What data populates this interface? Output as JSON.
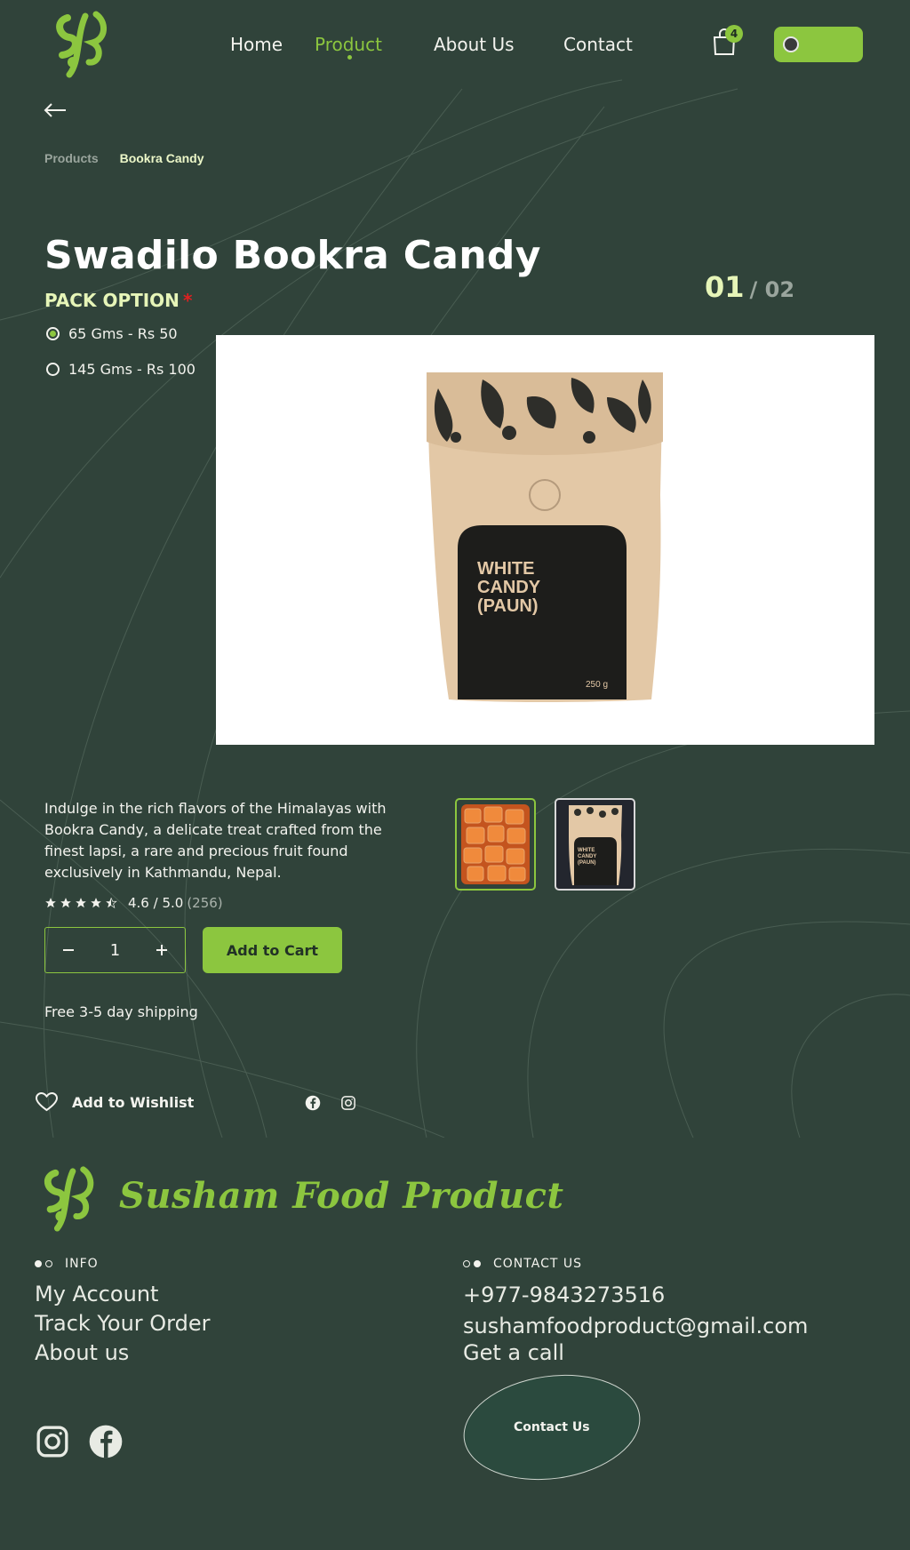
{
  "nav": {
    "links": [
      "Home",
      "Product",
      "About Us",
      "Contact"
    ],
    "active": "Product",
    "cart_count": "4"
  },
  "breadcrumb": [
    "Products",
    "Bookra Candy"
  ],
  "product": {
    "title": "Swadilo Bookra Candy",
    "pack_label": "PACK OPTION",
    "required_mark": "*",
    "options": [
      "65 Gms - Rs 50",
      "145 Gms - Rs 100"
    ],
    "selected_option": "65 Gms - Rs 50",
    "image_index": "01",
    "image_total": "/ 02",
    "package_text": [
      "WHITE",
      "CANDY",
      "(PAUN)"
    ],
    "package_weight": "250 g",
    "thumb_package_text": [
      "WHITE",
      "CANDY",
      "(PAUN)"
    ],
    "description": "Indulge in the rich flavors of the Himalayas with Bookra Candy, a delicate treat crafted from the finest lapsi, a rare and precious fruit found exclusively in Kathmandu, Nepal.",
    "rating_text": "4.6 / 5.0",
    "rating_count": "(256)",
    "rating_value": 4.6,
    "quantity": "1",
    "add_to_cart": "Add to Cart",
    "shipping": "Free 3-5 day shipping",
    "wishlist": "Add to Wishlist"
  },
  "footer": {
    "brand": "Susham Food Product",
    "info_heading": "INFO",
    "info_links": [
      "My Account",
      "Track Your Order",
      "About us"
    ],
    "contact_heading": "CONTACT US",
    "phone": "+977-9843273516",
    "email": "sushamfoodproduct@gmail.com",
    "call": "Get a call",
    "contact_button": "Contact Us"
  },
  "colors": {
    "background": "#30433a",
    "accent": "#8cc63f",
    "pale_accent": "#e6f5b8"
  },
  "icons": [
    "back-arrow-icon",
    "cart-icon",
    "heart-icon",
    "facebook-icon",
    "instagram-icon",
    "minus-icon",
    "plus-icon",
    "star-icon"
  ]
}
